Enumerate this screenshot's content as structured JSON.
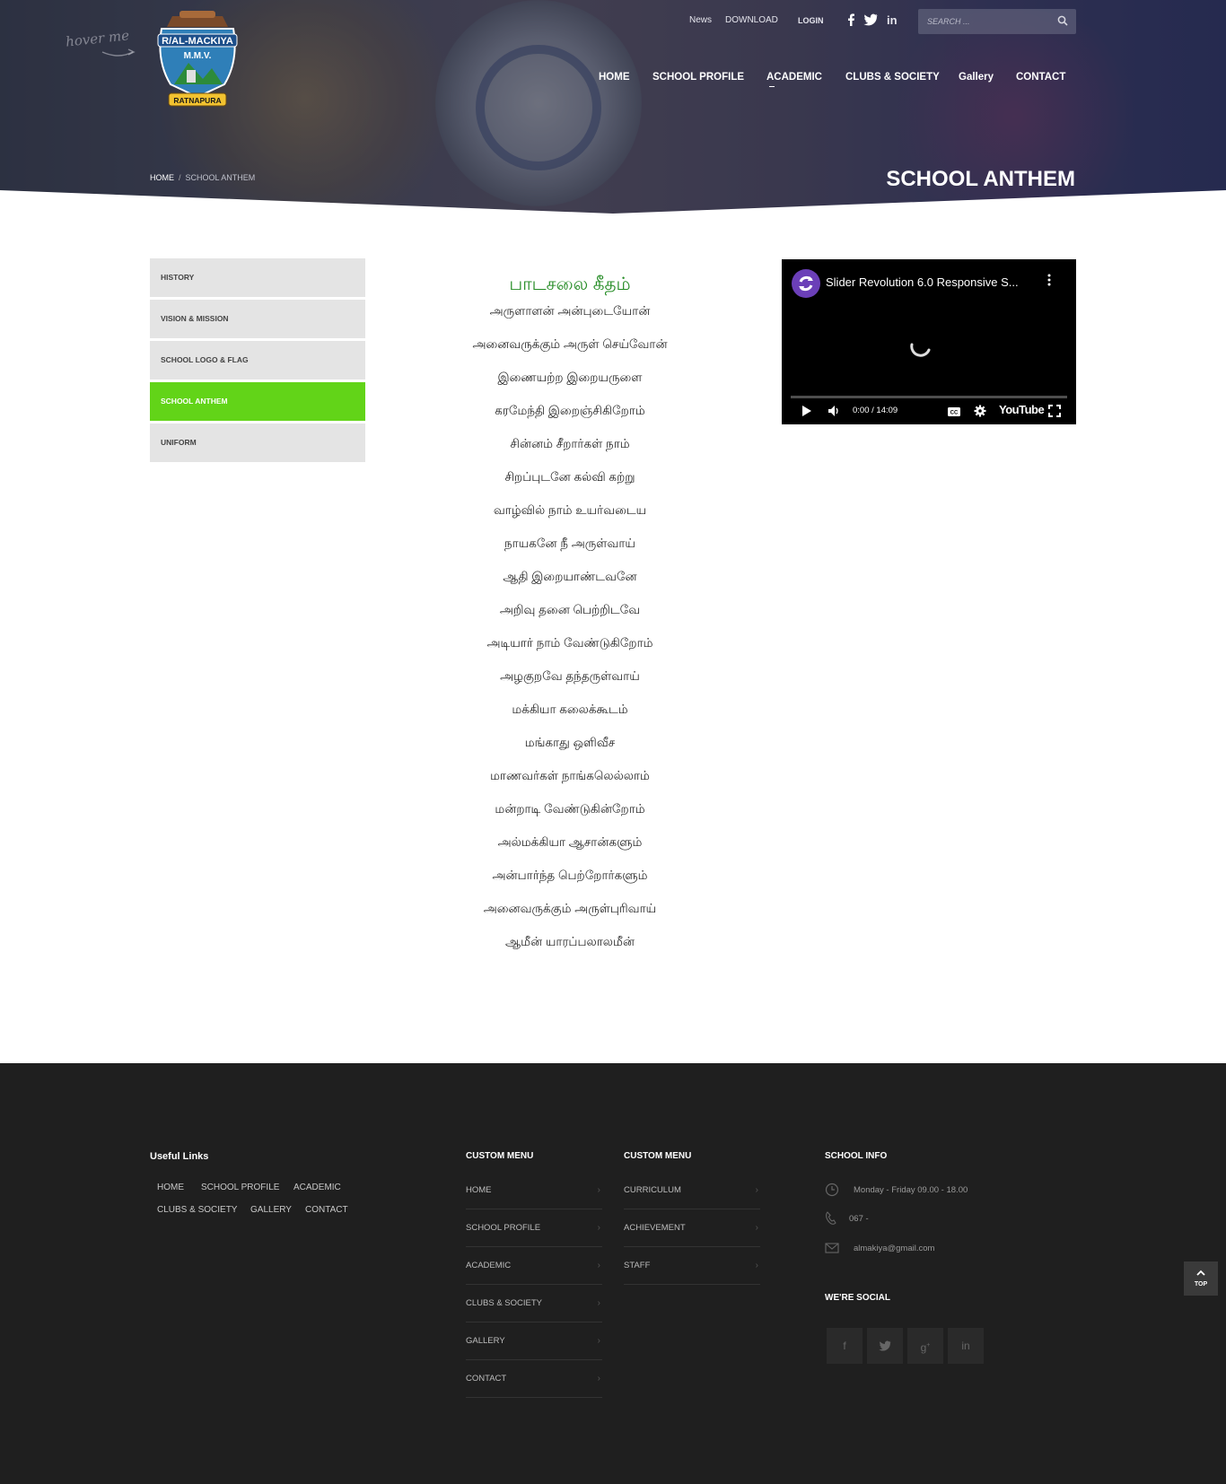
{
  "hero": {
    "hover_text": "hover me",
    "logo_lines": [
      "R/AL-MACKIYA",
      "M.M.V.",
      "RATNAPURA"
    ],
    "breadcrumb": {
      "home": "HOME",
      "separator": "/",
      "current": "SCHOOL ANTHEM"
    },
    "page_title": "SCHOOL ANTHEM"
  },
  "topbar": {
    "news": "News",
    "download": "DOWNLOAD",
    "login": "LOGIN",
    "search_placeholder": "SEARCH ..."
  },
  "nav": {
    "home": "HOME",
    "school_profile": "SCHOOL PROFILE",
    "academic": "ACADEMIC",
    "clubs": "CLUBS & SOCIETY",
    "gallery": "Gallery",
    "contact": "CONTACT"
  },
  "sidebar": {
    "items": [
      {
        "label": "HISTORY"
      },
      {
        "label": "VISION & MISSION"
      },
      {
        "label": "SCHOOL LOGO & FLAG"
      },
      {
        "label": "SCHOOL ANTHEM"
      },
      {
        "label": "UNIFORM"
      }
    ],
    "active_index": 3,
    "active_color": "#62d418"
  },
  "anthem": {
    "title": "பாடசலை கீதம்",
    "title_color": "#238b23",
    "lines": [
      "அருளாளன் அன்புடையோன்",
      "அனைவருக்கும் அருள் செய்வோன்",
      "இணையற்ற இறையருளை",
      "கரமேந்தி இறைஞ்சிகிறோம்",
      "சின்னம் சீறார்கள் நாம்",
      "சிறப்புடனே கல்வி கற்று",
      "வாழ்வில் நாம் உயர்வடைய",
      "நாயகனே நீ அருள்வாய்",
      "ஆதி இறையாண்டவனே",
      "அறிவு தனை பெற்றிடவே",
      "அடியார் நாம் வேண்டுகிறோம்",
      "அழகுறவே தந்தருள்வாய்",
      "மக்கியா கலைக்கூடம்",
      "மங்காது ஒளிவீச",
      "மாணவர்கள் நாங்கலெல்லாம்",
      "மன்றாடி வேண்டுகின்றோம்",
      "அல்மக்கியா ஆசான்களும்",
      "அன்பார்ந்த பெற்றோர்களும்",
      "அனைவருக்கும் அருள்புரிவாய்",
      "ஆமீன் யாரப்பலாலமீன்"
    ]
  },
  "video": {
    "title": "Slider Revolution 6.0 Responsive S...",
    "time": "0:00 / 14:09",
    "brand": "YouTube",
    "progress": 0
  },
  "footer": {
    "useful_links": {
      "heading": "Useful Links",
      "links": [
        "HOME",
        "SCHOOL PROFILE",
        "ACADEMIC",
        "CLUBS & SOCIETY",
        "GALLERY",
        "CONTACT"
      ]
    },
    "custom_menu_1": {
      "heading": "CUSTOM MENU",
      "items": [
        "HOME",
        "SCHOOL PROFILE",
        "ACADEMIC",
        "CLUBS & SOCIETY",
        "GALLERY",
        "CONTACT"
      ]
    },
    "custom_menu_2": {
      "heading": "CUSTOM MENU",
      "items": [
        "CURRICULUM",
        "ACHIEVEMENT",
        "STAFF"
      ]
    },
    "school_info": {
      "heading": "SCHOOL INFO",
      "hours": "Monday - Friday 09.00 - 18.00",
      "phone": "067 -",
      "email": "almakiya@gmail.com"
    },
    "social": {
      "heading": "WE'RE SOCIAL",
      "icons": [
        "facebook-icon",
        "twitter-icon",
        "google-plus-icon",
        "linkedin-icon"
      ]
    },
    "to_top": "TOP"
  }
}
